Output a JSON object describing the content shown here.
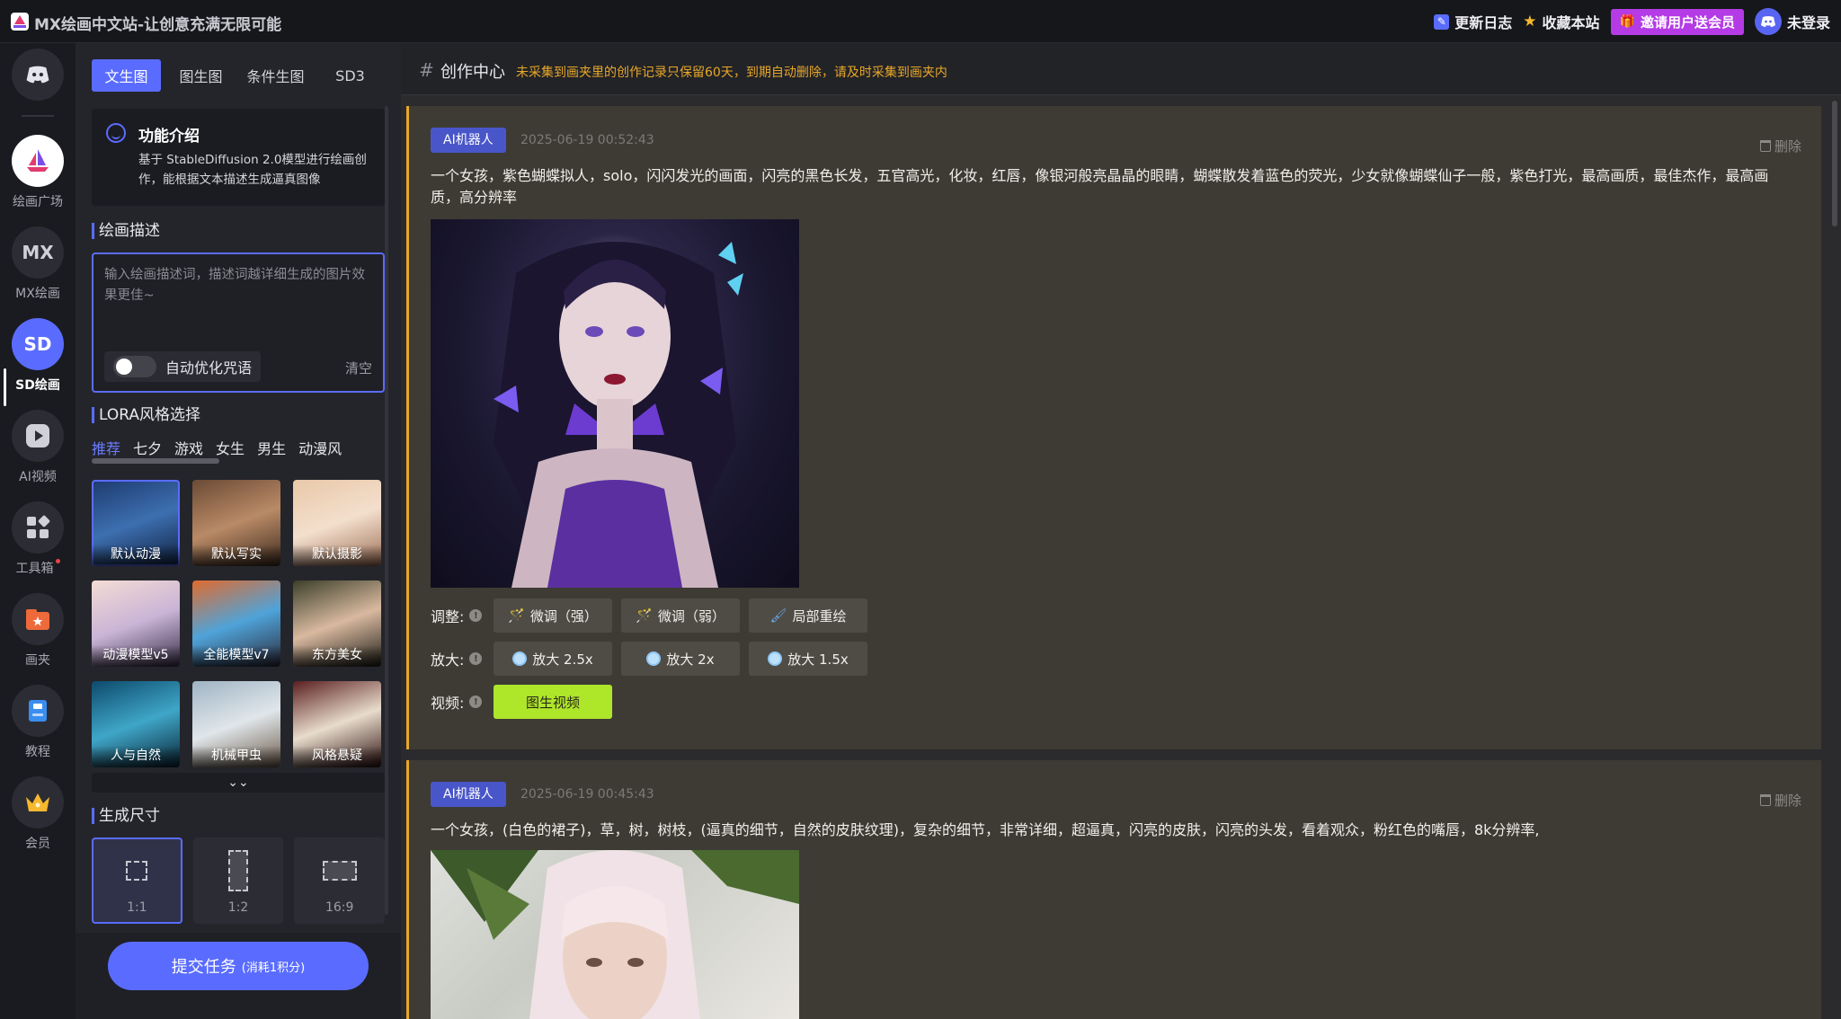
{
  "app": {
    "title": "MX绘画中文站-让创意充满无限可能"
  },
  "topbar": {
    "changelog": "更新日志",
    "bookmark": "收藏本站",
    "invite": "邀请用户送会员",
    "login": "未登录"
  },
  "nav": {
    "items": [
      {
        "label": "",
        "icon": "discord-icon"
      },
      {
        "label": "绘画广场",
        "icon": "sailboat-icon"
      },
      {
        "label": "MX绘画",
        "text": "MX"
      },
      {
        "label": "SD绘画",
        "text": "SD",
        "active": true
      },
      {
        "label": "AI视频",
        "icon": "play-icon"
      },
      {
        "label": "工具箱",
        "icon": "grid-icon"
      },
      {
        "label": "画夹",
        "icon": "folder-icon"
      },
      {
        "label": "教程",
        "icon": "book-icon"
      },
      {
        "label": "会员",
        "icon": "crown-icon"
      }
    ]
  },
  "panel": {
    "tabs": [
      "文生图",
      "图生图",
      "条件生图",
      "SD3"
    ],
    "intro": {
      "title": "功能介绍",
      "desc": "基于 StableDiffusion 2.0模型进行绘画创作，能根据文本描述生成逼真图像"
    },
    "prompt_section": "绘画描述",
    "prompt_placeholder": "输入绘画描述词，描述词越详细生成的图片效果更佳~",
    "auto_optimize": "自动优化咒语",
    "clear": "清空",
    "lora_section": "LORA风格选择",
    "lora_tabs": [
      "推荐",
      "七夕",
      "游戏",
      "女生",
      "男生",
      "动漫风"
    ],
    "lora_items": [
      "默认动漫",
      "默认写实",
      "默认摄影",
      "动漫模型v5",
      "全能模型v7",
      "东方美女",
      "人与自然",
      "机械甲虫",
      "风格悬疑"
    ],
    "size_section": "生成尺寸",
    "sizes": [
      "1:1",
      "1:2",
      "16:9"
    ],
    "submit": "提交任务",
    "submit_cost": "(消耗1积分)"
  },
  "main": {
    "title": "创作中心",
    "note": "未采集到画夹里的创作记录只保留60天，到期自动删除，请及时采集到画夹内",
    "cards": [
      {
        "badge": "AI机器人",
        "time": "2025-06-19 00:52:43",
        "delete": "删除",
        "prompt": "一个女孩，紫色蝴蝶拟人，solo，闪闪发光的画面，闪亮的黑色长发，五官高光，化妆，红唇，像银河般亮晶晶的眼睛，蝴蝶散发着蓝色的荧光，少女就像蝴蝶仙子一般，紫色打光，最高画质，最佳杰作，最高画质，高分辨率",
        "adjust_label": "调整:",
        "adjust": [
          "微调（强）",
          "微调（弱）",
          "局部重绘"
        ],
        "upscale_label": "放大:",
        "upscale": [
          "放大 2.5x",
          "放大 2x",
          "放大 1.5x"
        ],
        "video_label": "视频:",
        "video": "图生视频"
      },
      {
        "badge": "AI机器人",
        "time": "2025-06-19 00:45:43",
        "delete": "删除",
        "prompt": "一个女孩，(白色的裙子)，草，树，树枝，(逼真的细节，自然的皮肤纹理)，复杂的细节，非常详细，超逼真，闪亮的皮肤，闪亮的头发，看着观众，粉红色的嘴唇，8k分辨率,"
      }
    ]
  }
}
